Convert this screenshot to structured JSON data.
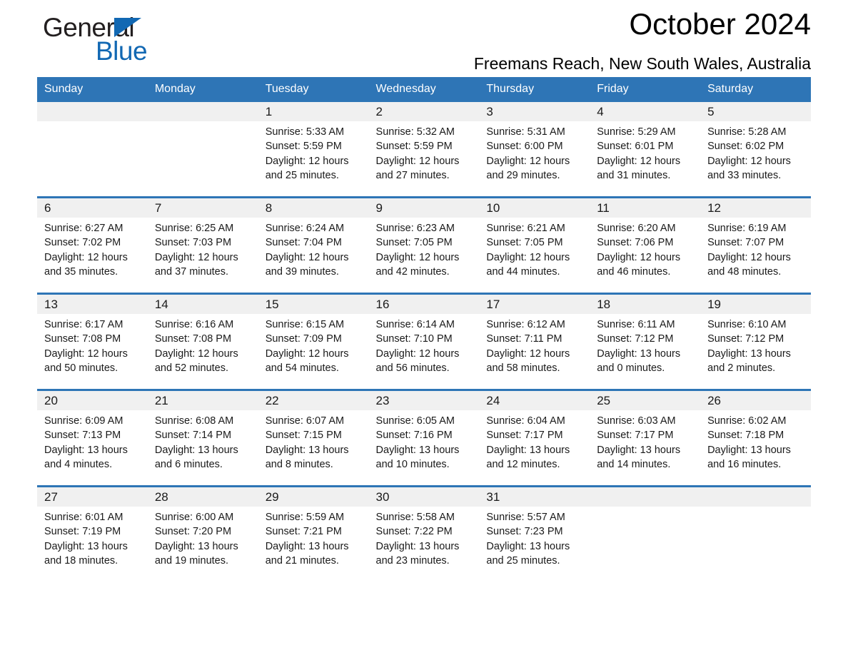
{
  "brand": {
    "name_dark": "General",
    "name_light": "Blue",
    "accent_color": "#1268b3"
  },
  "header": {
    "month_title": "October 2024",
    "location": "Freemans Reach, New South Wales, Australia",
    "header_bg_color": "#2e75b6",
    "daynum_band_color": "#f0f0f0"
  },
  "calendar": {
    "weekday_headers": [
      "Sunday",
      "Monday",
      "Tuesday",
      "Wednesday",
      "Thursday",
      "Friday",
      "Saturday"
    ],
    "weeks": [
      [
        {
          "empty": true
        },
        {
          "empty": true
        },
        {
          "day": "1",
          "sunrise": "Sunrise: 5:33 AM",
          "sunset": "Sunset: 5:59 PM",
          "daylight_1": "Daylight: 12 hours",
          "daylight_2": "and 25 minutes."
        },
        {
          "day": "2",
          "sunrise": "Sunrise: 5:32 AM",
          "sunset": "Sunset: 5:59 PM",
          "daylight_1": "Daylight: 12 hours",
          "daylight_2": "and 27 minutes."
        },
        {
          "day": "3",
          "sunrise": "Sunrise: 5:31 AM",
          "sunset": "Sunset: 6:00 PM",
          "daylight_1": "Daylight: 12 hours",
          "daylight_2": "and 29 minutes."
        },
        {
          "day": "4",
          "sunrise": "Sunrise: 5:29 AM",
          "sunset": "Sunset: 6:01 PM",
          "daylight_1": "Daylight: 12 hours",
          "daylight_2": "and 31 minutes."
        },
        {
          "day": "5",
          "sunrise": "Sunrise: 5:28 AM",
          "sunset": "Sunset: 6:02 PM",
          "daylight_1": "Daylight: 12 hours",
          "daylight_2": "and 33 minutes."
        }
      ],
      [
        {
          "day": "6",
          "sunrise": "Sunrise: 6:27 AM",
          "sunset": "Sunset: 7:02 PM",
          "daylight_1": "Daylight: 12 hours",
          "daylight_2": "and 35 minutes."
        },
        {
          "day": "7",
          "sunrise": "Sunrise: 6:25 AM",
          "sunset": "Sunset: 7:03 PM",
          "daylight_1": "Daylight: 12 hours",
          "daylight_2": "and 37 minutes."
        },
        {
          "day": "8",
          "sunrise": "Sunrise: 6:24 AM",
          "sunset": "Sunset: 7:04 PM",
          "daylight_1": "Daylight: 12 hours",
          "daylight_2": "and 39 minutes."
        },
        {
          "day": "9",
          "sunrise": "Sunrise: 6:23 AM",
          "sunset": "Sunset: 7:05 PM",
          "daylight_1": "Daylight: 12 hours",
          "daylight_2": "and 42 minutes."
        },
        {
          "day": "10",
          "sunrise": "Sunrise: 6:21 AM",
          "sunset": "Sunset: 7:05 PM",
          "daylight_1": "Daylight: 12 hours",
          "daylight_2": "and 44 minutes."
        },
        {
          "day": "11",
          "sunrise": "Sunrise: 6:20 AM",
          "sunset": "Sunset: 7:06 PM",
          "daylight_1": "Daylight: 12 hours",
          "daylight_2": "and 46 minutes."
        },
        {
          "day": "12",
          "sunrise": "Sunrise: 6:19 AM",
          "sunset": "Sunset: 7:07 PM",
          "daylight_1": "Daylight: 12 hours",
          "daylight_2": "and 48 minutes."
        }
      ],
      [
        {
          "day": "13",
          "sunrise": "Sunrise: 6:17 AM",
          "sunset": "Sunset: 7:08 PM",
          "daylight_1": "Daylight: 12 hours",
          "daylight_2": "and 50 minutes."
        },
        {
          "day": "14",
          "sunrise": "Sunrise: 6:16 AM",
          "sunset": "Sunset: 7:08 PM",
          "daylight_1": "Daylight: 12 hours",
          "daylight_2": "and 52 minutes."
        },
        {
          "day": "15",
          "sunrise": "Sunrise: 6:15 AM",
          "sunset": "Sunset: 7:09 PM",
          "daylight_1": "Daylight: 12 hours",
          "daylight_2": "and 54 minutes."
        },
        {
          "day": "16",
          "sunrise": "Sunrise: 6:14 AM",
          "sunset": "Sunset: 7:10 PM",
          "daylight_1": "Daylight: 12 hours",
          "daylight_2": "and 56 minutes."
        },
        {
          "day": "17",
          "sunrise": "Sunrise: 6:12 AM",
          "sunset": "Sunset: 7:11 PM",
          "daylight_1": "Daylight: 12 hours",
          "daylight_2": "and 58 minutes."
        },
        {
          "day": "18",
          "sunrise": "Sunrise: 6:11 AM",
          "sunset": "Sunset: 7:12 PM",
          "daylight_1": "Daylight: 13 hours",
          "daylight_2": "and 0 minutes."
        },
        {
          "day": "19",
          "sunrise": "Sunrise: 6:10 AM",
          "sunset": "Sunset: 7:12 PM",
          "daylight_1": "Daylight: 13 hours",
          "daylight_2": "and 2 minutes."
        }
      ],
      [
        {
          "day": "20",
          "sunrise": "Sunrise: 6:09 AM",
          "sunset": "Sunset: 7:13 PM",
          "daylight_1": "Daylight: 13 hours",
          "daylight_2": "and 4 minutes."
        },
        {
          "day": "21",
          "sunrise": "Sunrise: 6:08 AM",
          "sunset": "Sunset: 7:14 PM",
          "daylight_1": "Daylight: 13 hours",
          "daylight_2": "and 6 minutes."
        },
        {
          "day": "22",
          "sunrise": "Sunrise: 6:07 AM",
          "sunset": "Sunset: 7:15 PM",
          "daylight_1": "Daylight: 13 hours",
          "daylight_2": "and 8 minutes."
        },
        {
          "day": "23",
          "sunrise": "Sunrise: 6:05 AM",
          "sunset": "Sunset: 7:16 PM",
          "daylight_1": "Daylight: 13 hours",
          "daylight_2": "and 10 minutes."
        },
        {
          "day": "24",
          "sunrise": "Sunrise: 6:04 AM",
          "sunset": "Sunset: 7:17 PM",
          "daylight_1": "Daylight: 13 hours",
          "daylight_2": "and 12 minutes."
        },
        {
          "day": "25",
          "sunrise": "Sunrise: 6:03 AM",
          "sunset": "Sunset: 7:17 PM",
          "daylight_1": "Daylight: 13 hours",
          "daylight_2": "and 14 minutes."
        },
        {
          "day": "26",
          "sunrise": "Sunrise: 6:02 AM",
          "sunset": "Sunset: 7:18 PM",
          "daylight_1": "Daylight: 13 hours",
          "daylight_2": "and 16 minutes."
        }
      ],
      [
        {
          "day": "27",
          "sunrise": "Sunrise: 6:01 AM",
          "sunset": "Sunset: 7:19 PM",
          "daylight_1": "Daylight: 13 hours",
          "daylight_2": "and 18 minutes."
        },
        {
          "day": "28",
          "sunrise": "Sunrise: 6:00 AM",
          "sunset": "Sunset: 7:20 PM",
          "daylight_1": "Daylight: 13 hours",
          "daylight_2": "and 19 minutes."
        },
        {
          "day": "29",
          "sunrise": "Sunrise: 5:59 AM",
          "sunset": "Sunset: 7:21 PM",
          "daylight_1": "Daylight: 13 hours",
          "daylight_2": "and 21 minutes."
        },
        {
          "day": "30",
          "sunrise": "Sunrise: 5:58 AM",
          "sunset": "Sunset: 7:22 PM",
          "daylight_1": "Daylight: 13 hours",
          "daylight_2": "and 23 minutes."
        },
        {
          "day": "31",
          "sunrise": "Sunrise: 5:57 AM",
          "sunset": "Sunset: 7:23 PM",
          "daylight_1": "Daylight: 13 hours",
          "daylight_2": "and 25 minutes."
        },
        {
          "empty": true
        },
        {
          "empty": true
        }
      ]
    ]
  }
}
